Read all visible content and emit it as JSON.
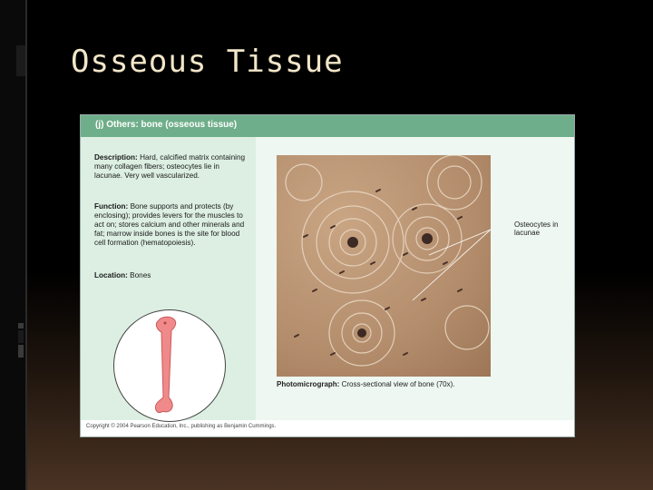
{
  "slide": {
    "title": "Osseous Tissue"
  },
  "panel": {
    "header": "(j) Others: bone (osseous tissue)",
    "description_label": "Description:",
    "description_text": "Hard, calcified matrix containing many collagen fibers; osteocytes lie in lacunae. Very well vascularized.",
    "function_label": "Function:",
    "function_text": "Bone supports and protects (by enclosing); provides levers for the muscles to act on; stores calcium and other minerals and fat; marrow inside bones is the site for blood cell formation (hematopoiesis).",
    "location_label": "Location:",
    "location_text": "Bones",
    "osteocytes_label": "Osteocytes in lacunae",
    "caption_label": "Photomicrograph:",
    "caption_text": "Cross-sectional view of bone (70x).",
    "copyright": "Copyright © 2004 Pearson Education, Inc., publishing as Benjamin Cummings."
  },
  "colors": {
    "header_green": "#6fae8a",
    "text_panel_green": "#dcefe2",
    "bone_pink": "#f08a8a",
    "title_color": "#f2e6c8"
  }
}
